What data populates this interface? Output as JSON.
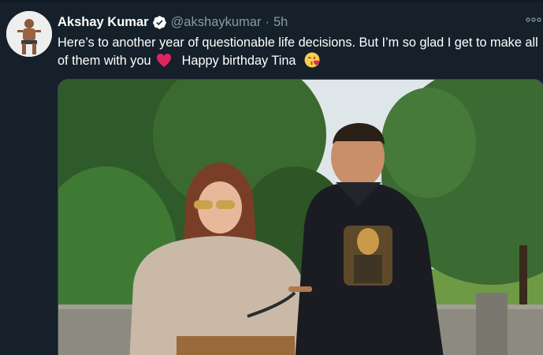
{
  "tweet": {
    "display_name": "Akshay Kumar",
    "handle": "@akshaykumar",
    "separator": "·",
    "time": "5h",
    "text_part1": "Here’s to another year of questionable life decisions. But I’m so glad I get to make all of them with you",
    "text_part2": "Happy birthday Tina",
    "emoji_1": "red-heart-icon",
    "emoji_2": "face-blowing-kiss-icon"
  },
  "icons": {
    "verified": "verified-badge-icon",
    "more": "more-options-icon"
  },
  "colors": {
    "background": "#15202b",
    "secondary_text": "#8899a6",
    "verified_blue": "#ffffff",
    "heart_red": "#e0245e"
  }
}
